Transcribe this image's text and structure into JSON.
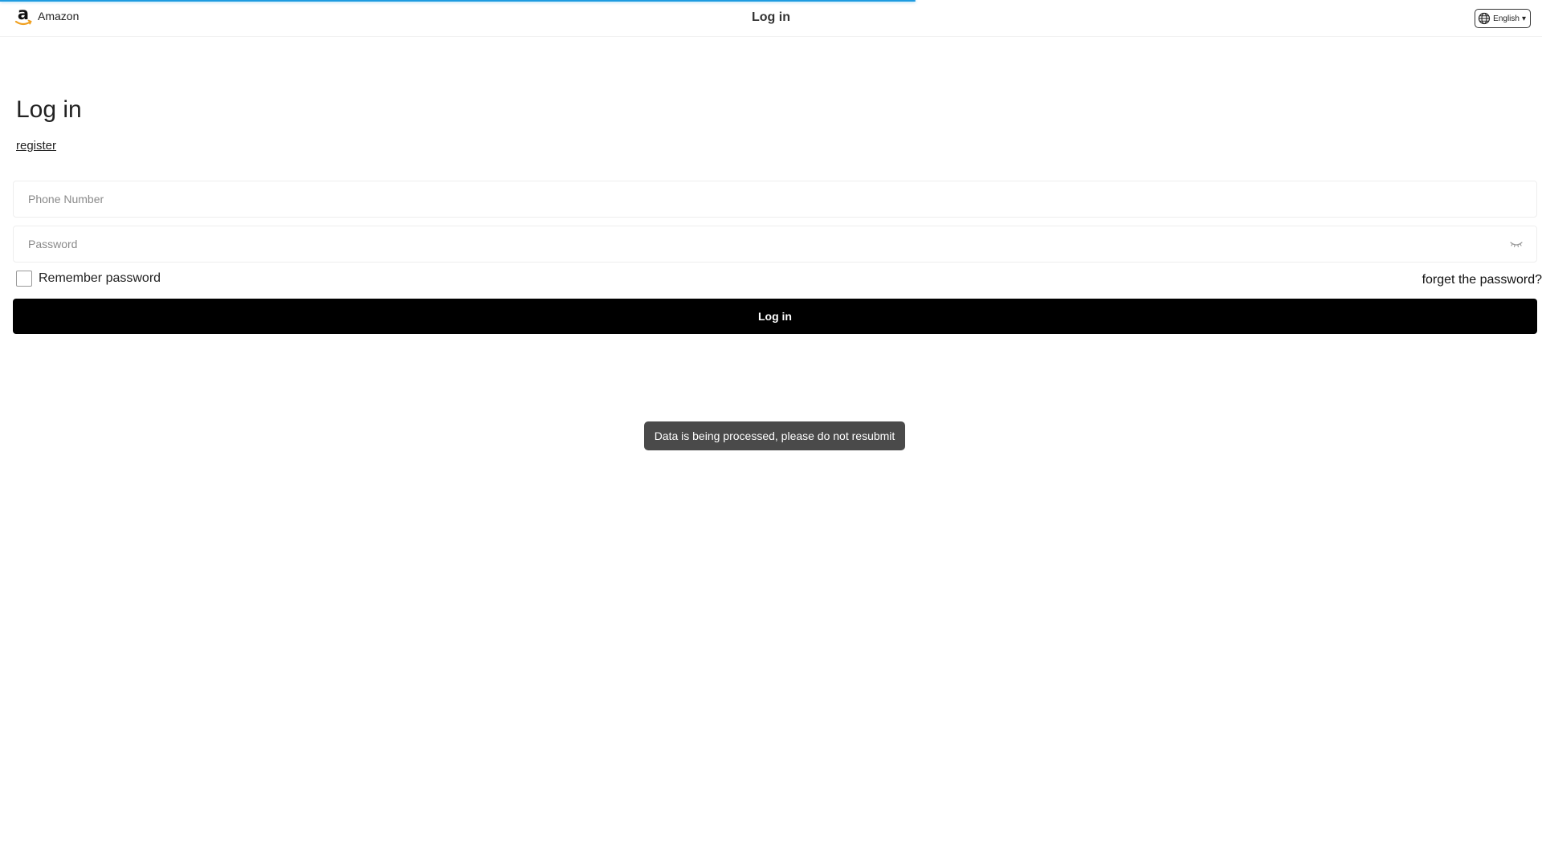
{
  "loading": {
    "progress": 0.594,
    "color": "#1e9be0"
  },
  "header": {
    "brand_name": "Amazon",
    "brand_logo_icon": "amazon-a-smile-logo",
    "title": "Log in",
    "language": {
      "label": "English",
      "arrow": "▾",
      "icon": "globe-icon"
    }
  },
  "main": {
    "heading": "Log in",
    "register_link": "register",
    "phone": {
      "placeholder": "Phone Number",
      "value": ""
    },
    "password": {
      "placeholder": "Password",
      "value": "",
      "toggle_icon": "eye-closed-icon"
    },
    "remember": {
      "label": "Remember password",
      "checked": false
    },
    "forget_link": "forget the password?",
    "submit_label": "Log in"
  },
  "toast": {
    "message": "Data is being processed, please do not resubmit"
  },
  "colors": {
    "button_bg": "#000000",
    "toast_bg": "#4a4a4a",
    "logo_smile": "#f0a020"
  }
}
